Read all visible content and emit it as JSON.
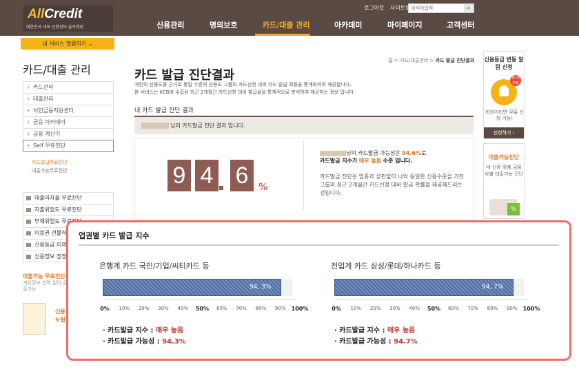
{
  "header": {
    "logo_text_all": "All",
    "logo_text_credit": "Credit",
    "logo_sub": "대한민국 대표 신용정보 솔루레딧",
    "logout": "로그아웃",
    "sitemap": "사이트맵",
    "search_placeholder": "검색어입력",
    "nav": [
      "신용관리",
      "명의보호",
      "카드/대출 관리",
      "아카데미",
      "마이페이지",
      "고객센터"
    ],
    "active_nav": "카드/대출 관리"
  },
  "sidebar": {
    "my_service": "내 서비스 열람하기 ⌄",
    "title": "카드/대출 관리",
    "items": [
      "카드관리",
      "대출관리",
      "서민금융지원센터",
      "금융 아카데미",
      "금융 계산기",
      "Self 무료진단"
    ],
    "subitems": [
      "카드발급무료진단",
      "대출가능무료진단"
    ],
    "quick_links": [
      "대출이자율 무료진단",
      "지출위험도 무료진단",
      "부채위험도 무료진단",
      "이용권 선물하기",
      "신용등급 이의신",
      "신용정보 정정청"
    ],
    "promo_title": "대출가능 무료진단",
    "promo_desc": "개인정보 입력 없이 금융사 간편한 통계로 대출가능",
    "promo2_l1": "신용",
    "promo2_l2": "누릴"
  },
  "main": {
    "breadcrumb_home": "홈",
    "breadcrumb_mid": "카드/대출관리",
    "breadcrumb_cur": "카드 발급 진단결과",
    "title": "카드 발급 진단결과",
    "desc1": "개인의 신용도를 근거로 동일 수준의 신용도 그룹의 카드신청 대비 카드 발급 확률을 통계화하여 제공합니다.",
    "desc2": "본 서비스는 KCB에 수집된 최근 2개월간 카드신청 대비 발급율을 통계적으로 분석하여 제공하는 정보 입니다.",
    "sub_title": "내 카드 발급 진단 결과",
    "result_bar_text": "님의 카드발급 진단 결과 입니다.",
    "digits": [
      "9",
      "4",
      "6"
    ],
    "percent_sign": "%",
    "result_line1a": "님의 카드발급 가능성은",
    "result_line1b": "94.6%",
    "result_line1c": "로",
    "result_line2a": "카드발급 지수가",
    "result_line2b": "매우 높음",
    "result_line2c": "수준 입니다.",
    "result_desc": "카드발급 진단은 업종과 상관없이 나와 동일한 신용수준을 가진 그룹의 최근 2개월간 카드신청 대비 발급 확률을 제공해드리는 것입니다."
  },
  "right_widgets": {
    "w1_title": "신용등급 변동 알람 신청",
    "w1_badge": "월2회 무료",
    "w1_desc": "회원이라면 무료 신청 가능!",
    "w1_button": "신청하기 ›",
    "w2_title": "대출가능진단",
    "w2_desc": "내 신용 맞춤 금융사별 대출가능 진단",
    "w2_badge": "%"
  },
  "popup": {
    "title": "업권별 카드 발급 지수",
    "ticks": [
      "0%",
      "10%",
      "20%",
      "30%",
      "40%",
      "50%",
      "60%",
      "70%",
      "80%",
      "90%",
      "100%"
    ],
    "sections": [
      {
        "title": "은행계 카드  국민/기업/씨티카드 등",
        "value": 94.3,
        "value_label": "94, 3%",
        "stat1_label": "· 카드발급 지수 : ",
        "stat1_value": "매우 높음",
        "stat2_label": "· 카드발급 가능성 : ",
        "stat2_value": "94.3%"
      },
      {
        "title": "전업계 카드  삼성/롯데/하나카드 등",
        "value": 94.7,
        "value_label": "94, 7%",
        "stat1_label": "· 카드발급 지수 : ",
        "stat1_value": "매우 높음",
        "stat2_label": "· 카드발급 가능성 : ",
        "stat2_value": "94.7%"
      }
    ]
  }
}
